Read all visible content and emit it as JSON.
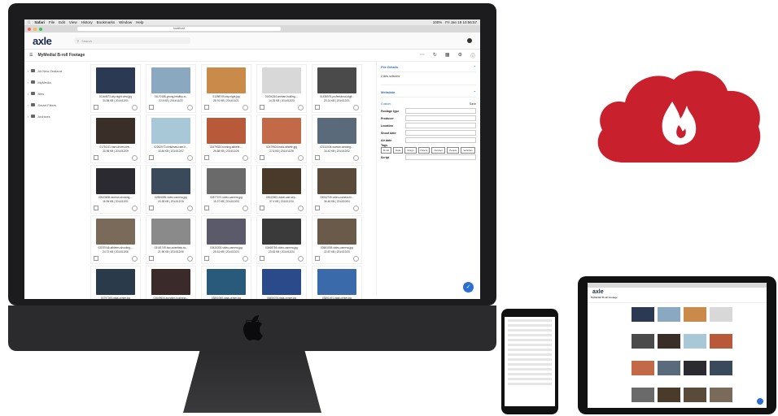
{
  "menubar": {
    "items": [
      "Safari",
      "File",
      "Edit",
      "View",
      "History",
      "Bookmarks",
      "Window",
      "Help"
    ],
    "status": [
      "100%",
      "Fri Jan 19  10:56:57"
    ]
  },
  "browser": {
    "url": "localhost"
  },
  "app": {
    "logo": "axle",
    "search_placeholder": "Search",
    "breadcrumb": "MyMedia/ B-roll Footage"
  },
  "sidebar": {
    "items": [
      {
        "label": "Air New Zealand",
        "icon": "folder-icon"
      },
      {
        "label": "MyMedia",
        "icon": "folder-icon"
      },
      {
        "label": "Bins",
        "icon": "folder-icon"
      },
      {
        "label": "Smart Filters",
        "icon": "filter-icon"
      },
      {
        "label": "Archives",
        "icon": "archive-icon"
      }
    ]
  },
  "files": [
    {
      "name": "01164573-city-night-view.jpg",
      "meta": "34.98 KB | 2014/12/01",
      "color": "#2b3a52"
    },
    {
      "name": "01170186-young-healthy-a...",
      "meta": "22.8 KB | 2014/11/22",
      "color": "#8aa8c0"
    },
    {
      "name": "01258749-city-night.jpg",
      "meta": "28.91 KB | 2014/11/21",
      "color": "#c98a4a"
    },
    {
      "name": "01434254-woman-holding-...",
      "meta": "14.25 KB | 2014/12/20",
      "color": "#d8d8d8"
    },
    {
      "name": "01436976-professional-digit...",
      "meta": "23.14 KB | 2014/12/21",
      "color": "#4a4a4a"
    },
    {
      "name": "01751111-hard-drives-driv...",
      "meta": "30.98 KB | 2014/12/09",
      "color": "#3a2f28"
    },
    {
      "name": "02262072-christmas-card-h...",
      "meta": "15.84 KB | 2014/12/07",
      "color": "#a8c8d8"
    },
    {
      "name": "02479320-running-athlete-...",
      "meta": "26.68 KB | 2014/11/26",
      "color": "#b85a3a"
    },
    {
      "name": "02479524-track-athlete.jpg",
      "meta": "27.8 KB | 2014/11/28",
      "color": "#c26a48"
    },
    {
      "name": "02161034-woman-wearing-...",
      "meta": "34.42 KB | 2014/12/02",
      "color": "#5a6a7a"
    },
    {
      "name": "02643608-woman-showing-...",
      "meta": "16.95 KB | 2014/12/01",
      "color": "#2a2a30"
    },
    {
      "name": "02854555-video-camera.jpg",
      "meta": "20.28 KB | 2014/12/15",
      "color": "#3a4a5a"
    },
    {
      "name": "02877070-video-camera.jpg",
      "meta": "15.37 KB | 2014/12/04",
      "color": "#6a6a6a"
    },
    {
      "name": "03043063-dubai-uae-sep...",
      "meta": "37.4 KB | 2014/12/10",
      "color": "#4a3a2a"
    },
    {
      "name": "03062749-video-camera-bl...",
      "meta": "36.46 KB | 2014/10/04",
      "color": "#5a4a3a"
    },
    {
      "name": "03187046-athletes-shooting-...",
      "meta": "24.72 KB | 2014/12/06",
      "color": "#7a6a5a"
    },
    {
      "name": "03181749-two-scientists-ta...",
      "meta": "21.96 KB | 2014/12/06",
      "color": "#8a8a8a"
    },
    {
      "name": "03434303-video-camera.jpg",
      "meta": "25.51 KB | 2014/12/24",
      "color": "#5a5a6a"
    },
    {
      "name": "03468754-video-camera.jpg",
      "meta": "23.63 KB | 2014/12/24",
      "color": "#3a3a3a"
    },
    {
      "name": "03661009-video-camera.jpg",
      "meta": "22.87 KB | 2014/12/20",
      "color": "#6a5a4a"
    },
    {
      "name": "03797393-data-center.jpg",
      "meta": "39.57 KB | 2014/12/30",
      "color": "#2a3a4a"
    },
    {
      "name": "03849606-speaker-business...",
      "meta": "22.18 KB | 2014/12/18",
      "color": "#3a2a2a"
    },
    {
      "name": "03850050-data-center.jpg",
      "meta": "36.05 KB | 2014/12/31",
      "color": "#2a5a7a"
    },
    {
      "name": "03850076-data-center.jpg",
      "meta": "56.45 KB | 2014/01/01",
      "color": "#2a4a8a"
    },
    {
      "name": "03851491-data-center.jpg",
      "meta": "49.44 KB | 2014/12/18",
      "color": "#3a6aaa"
    }
  ],
  "panel": {
    "details_title": "File Details",
    "details_sub": "2 files selected",
    "metadata_title": "Metadata",
    "custom_label": "Custom",
    "save_label": "Save",
    "fields": [
      "Footage type",
      "Producer",
      "Location",
      "Shoot date",
      "Air date"
    ],
    "tags_label": "Tags",
    "tags": [
      "B-roll",
      "Data",
      "Drago",
      "Patent",
      "Outdoor",
      "People",
      "Vehicles"
    ],
    "script_label": "Script"
  },
  "colors": {
    "accent": "#2c6fd0",
    "cloud": "#c8202c"
  }
}
